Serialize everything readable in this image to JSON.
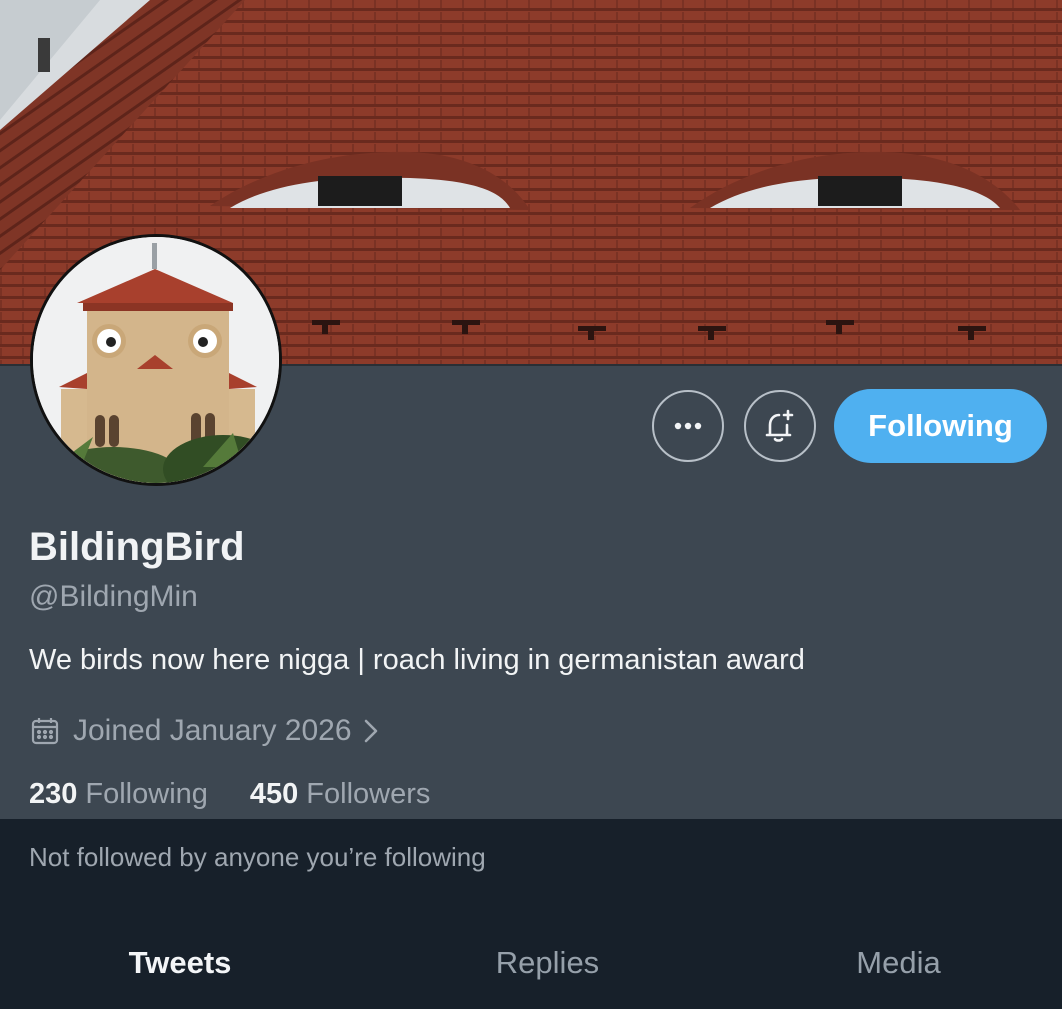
{
  "banner": {
    "alt": ""
  },
  "profile": {
    "display_name": "BildingBird",
    "username": "@BildingMin",
    "bio": "We birds now here nigga | roach living in germanistan award",
    "joined": "Joined January 2026",
    "following_count": "230",
    "following_label": "Following",
    "followers_count": "450",
    "followers_label": "Followers",
    "not_followed": "Not followed by anyone you’re following"
  },
  "actions": {
    "more_label": "•••",
    "follow_label": "Following"
  },
  "tabs": [
    {
      "label": "Tweets",
      "active": true
    },
    {
      "label": "Replies",
      "active": false
    },
    {
      "label": "Media",
      "active": false
    }
  ],
  "colors": {
    "accent": "#4fb0f0",
    "profile_bg": "#3d4751",
    "page_bg": "#17202a",
    "roof": "#8b3a28"
  },
  "icons": [
    "more-icon",
    "bell-plus-icon",
    "calendar-icon",
    "chevron-right-icon"
  ]
}
